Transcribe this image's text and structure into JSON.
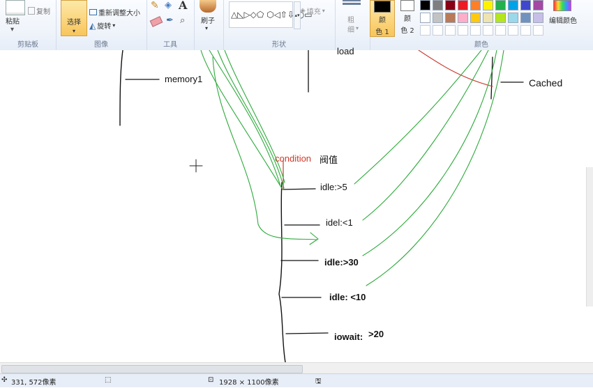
{
  "ribbon": {
    "clipboard": {
      "paste": "粘贴",
      "paste_arrow": "▾",
      "copy": "复制",
      "group": "剪贴板"
    },
    "image": {
      "select": "选择",
      "select_arrow": "▾",
      "resize": "重新调整大小",
      "rotate": "旋转",
      "rotate_arrow": "▾",
      "group": "图像"
    },
    "tools": {
      "group": "工具"
    },
    "brushes": {
      "label": "刷子",
      "arrow": "▾"
    },
    "shapes": {
      "group": "形状",
      "fill": "填充",
      "fill_arrow": "▾"
    },
    "size": {
      "label_top": "粗",
      "label_bottom": "细",
      "arrow": "▾"
    },
    "color1": {
      "label_top": "颜",
      "label_bottom": "色 1"
    },
    "color2": {
      "label_top": "颜",
      "label_bottom": "色 2"
    },
    "colors": {
      "group": "颜色",
      "edit": "编辑颜色",
      "row1": [
        "#000000",
        "#7f7f7f",
        "#880015",
        "#ed1c24",
        "#ff7f27",
        "#fff200",
        "#22b14c",
        "#00a2e8",
        "#3f48cc",
        "#a349a4"
      ],
      "row2": [
        "#ffffff",
        "#c3c3c3",
        "#b97a57",
        "#ffaec9",
        "#ffc90e",
        "#efe4b0",
        "#b5e61d",
        "#99d9ea",
        "#7092be",
        "#c8bfe7"
      ]
    }
  },
  "canvas": {
    "annotations": {
      "memory": "memory1",
      "load": "load",
      "cached": "Cached",
      "condition": "condition",
      "threshold": "阀值",
      "idle_gt5": "idle:>5",
      "idel_lt1": "idel:<1",
      "idle_gt30": "idle:>30",
      "idle_lt10": "idle: <10",
      "iowait": "iowait:",
      "iowait_val": ">20"
    },
    "colors": {
      "ink": "#111111",
      "green": "#2eaa3c",
      "red": "#d0382a"
    }
  },
  "status": {
    "cursor_pos": "331, 572像素",
    "image_size": "1928 × 1100像素"
  }
}
